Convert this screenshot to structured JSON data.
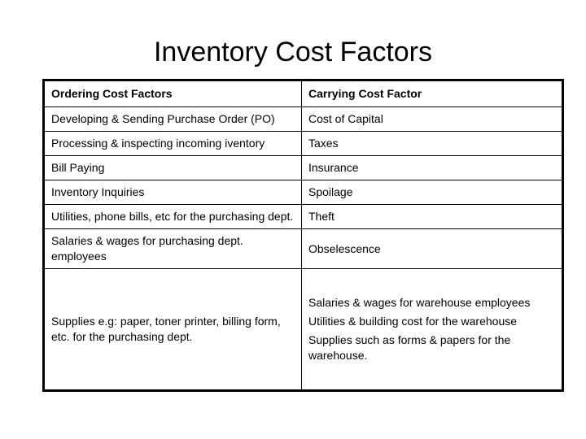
{
  "slide": {
    "title": "Inventory Cost Factors",
    "background_color": "#ffffff",
    "text_color": "#000000",
    "border_color": "#000000"
  },
  "table": {
    "columns": [
      {
        "header": "Ordering Cost Factors"
      },
      {
        "header": "Carrying Cost Factor"
      }
    ],
    "rows": [
      {
        "ordering": [
          "Developing & Sending Purchase Order (PO)"
        ],
        "carrying": [
          "Cost of Capital"
        ]
      },
      {
        "ordering": [
          "Processing & inspecting incoming iventory"
        ],
        "carrying": [
          "Taxes"
        ]
      },
      {
        "ordering": [
          "Bill Paying"
        ],
        "carrying": [
          "Insurance"
        ]
      },
      {
        "ordering": [
          "Inventory Inquiries"
        ],
        "carrying": [
          "Spoilage"
        ]
      },
      {
        "ordering": [
          "Utilities, phone bills, etc for the purchasing dept."
        ],
        "carrying": [
          "Theft"
        ]
      },
      {
        "ordering": [
          "Salaries & wages for purchasing dept. employees"
        ],
        "carrying": [
          "Obselescence"
        ]
      },
      {
        "ordering": [
          "Supplies e.g: paper, toner printer, billing form, etc. for the purchasing dept."
        ],
        "carrying": [
          "Salaries & wages for warehouse employees",
          "Utilities & building cost for the warehouse",
          "Supplies such as forms & papers for the warehouse."
        ]
      }
    ]
  }
}
